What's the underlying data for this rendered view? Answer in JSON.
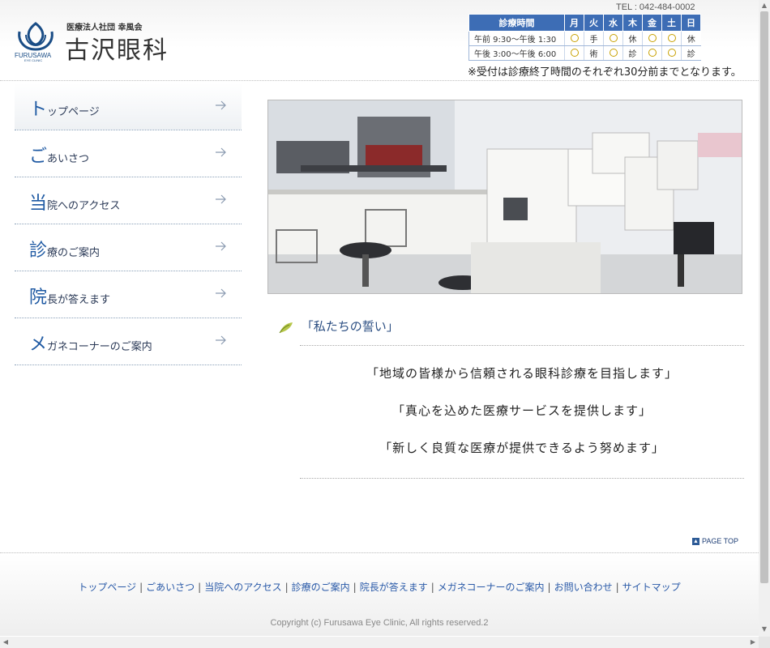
{
  "header": {
    "org": "医療法人社団 幸風会",
    "clinic_name": "古沢眼科",
    "logo_en": "FURUSAWA",
    "logo_en_sub": "EYE CLINIC",
    "tel": "TEL : 042-484-0002",
    "hours": {
      "label": "診療時間",
      "days": [
        "月",
        "火",
        "水",
        "木",
        "金",
        "土",
        "日"
      ],
      "rows": [
        {
          "period": "午前 9:30〜午後 1:30",
          "cells": [
            "○",
            "手",
            "○",
            "休",
            "○",
            "○",
            "休"
          ]
        },
        {
          "period": "午後 3:00〜午後 6:00",
          "cells": [
            "○",
            "術",
            "○",
            "診",
            "○",
            "○",
            "診"
          ]
        }
      ]
    },
    "notice": "※受付は診療終了時間のそれぞれ30分前までとなります。"
  },
  "nav": [
    {
      "first": "ト",
      "rest": "ップページ",
      "active": true
    },
    {
      "first": "ご",
      "rest": "あいさつ"
    },
    {
      "first": "当",
      "rest": "院へのアクセス"
    },
    {
      "first": "診",
      "rest": "療のご案内"
    },
    {
      "first": "院",
      "rest": "長が答えます"
    },
    {
      "first": "メ",
      "rest": "ガネコーナーのご案内"
    }
  ],
  "pledge": {
    "title": "「私たちの誓い」",
    "items": [
      "「地域の皆様から信頼される眼科診療を目指します」",
      "「真心を込めた医療サービスを提供します」",
      "「新しく良質な医療が提供できるよう努めます」"
    ]
  },
  "page_top": "PAGE TOP",
  "footer": {
    "links": [
      "トップページ",
      "ごあいさつ",
      "当院へのアクセス",
      "診療のご案内",
      "院長が答えます",
      "メガネコーナーのご案内",
      "お問い合わせ",
      "サイトマップ"
    ],
    "separator": "|",
    "copyright": "Copyright (c) Furusawa Eye Clinic, All rights reserved.2"
  },
  "colors": {
    "brand_blue": "#1f5aa3",
    "table_header": "#3d6db5",
    "link": "#2a5aa8"
  }
}
